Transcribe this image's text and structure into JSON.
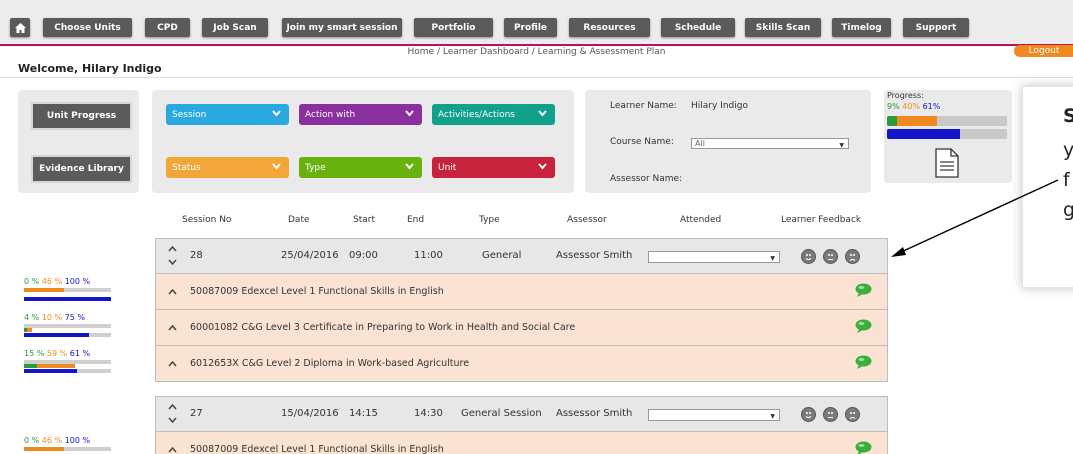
{
  "nav": {
    "items": [
      "Choose Units",
      "CPD",
      "Job Scan",
      "Join my smart session",
      "Portfolio",
      "Profile",
      "Resources",
      "Schedule",
      "Skills Scan",
      "Timelog",
      "Support"
    ]
  },
  "breadcrumb": "Home / Learner Dashboard / Learning & Assessment Plan",
  "logout": "Logout",
  "welcome": "Welcome, Hilary Indigo",
  "left_buttons": {
    "unit_progress": "Unit Progress",
    "evidence_library": "Evidence Library"
  },
  "filters": [
    {
      "label": "Session",
      "color": "#29a9df"
    },
    {
      "label": "Action with",
      "color": "#8a2f9e"
    },
    {
      "label": "Activities/Actions",
      "color": "#11a08a"
    },
    {
      "label": "Status",
      "color": "#f2a63a"
    },
    {
      "label": "Type",
      "color": "#69b10f"
    },
    {
      "label": "Unit",
      "color": "#c8233d"
    }
  ],
  "learner": {
    "name_label": "Learner Name:",
    "name_value": "Hilary Indigo",
    "course_label": "Course Name:",
    "course_value": "All",
    "assessor_label": "Assessor Name:",
    "assessor_value": ""
  },
  "progress": {
    "label": "Progress:",
    "p1": "9",
    "p2": "40",
    "p3": "61",
    "pct": "%",
    "filled": 0.61
  },
  "callout_letters": [
    "S",
    "y",
    "f",
    "g"
  ],
  "table_headers": [
    "Session No",
    "Date",
    "Start",
    "End",
    "Type",
    "Assessor",
    "Attended",
    "Learner Feedback"
  ],
  "sessions": [
    {
      "no": "28",
      "date": "25/04/2016",
      "start": "09:00",
      "end": "11:00",
      "type": "General",
      "assessor": "Assessor Smith",
      "units": [
        "50087009 Edexcel Level 1 Functional Skills in English",
        "60001082 C&G Level 3 Certificate in Preparing to Work in Health and Social Care",
        "6012653X C&G Level 2 Diploma in Work-based Agriculture"
      ]
    },
    {
      "no": "27",
      "date": "15/04/2016",
      "start": "14:15",
      "end": "14:30",
      "type": "General Session",
      "assessor": "Assessor Smith",
      "units": [
        "50087009 Edexcel Level 1 Functional Skills in English"
      ]
    }
  ],
  "unit_stats": [
    {
      "a": "0",
      "b": "46",
      "c": "100",
      "pct": "%"
    },
    {
      "a": "4",
      "b": "10",
      "c": "75",
      "pct": "%"
    },
    {
      "a": "15",
      "b": "59",
      "c": "61",
      "pct": "%"
    },
    {
      "a": "0",
      "b": "46",
      "c": "100",
      "pct": "%"
    }
  ],
  "colors": {
    "accent": "#b5125e",
    "orange": "#f08a1e",
    "blue": "#1414c8",
    "green": "#2a9a3a",
    "unit_row": "#fbe3d3"
  }
}
